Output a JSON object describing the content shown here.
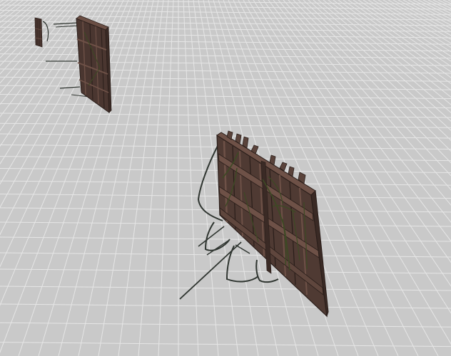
{
  "scene": {
    "background_color": "#c9c9c9",
    "grid_line_color": "#e6e6e6",
    "grid_minor_color": "#bdbdbd",
    "wood_dark": "#3a2a25",
    "wood_mid": "#5a433b",
    "wood_light": "#6e5147",
    "vine_color": "#3d4a24",
    "stick_color": "#2f3530",
    "objects": [
      {
        "name": "small-barricade",
        "description_icon": "wooden-barricade-icon"
      },
      {
        "name": "medium-barricade",
        "description_icon": "wooden-barricade-icon"
      },
      {
        "name": "large-barricade",
        "description_icon": "wooden-barricade-icon"
      }
    ]
  }
}
